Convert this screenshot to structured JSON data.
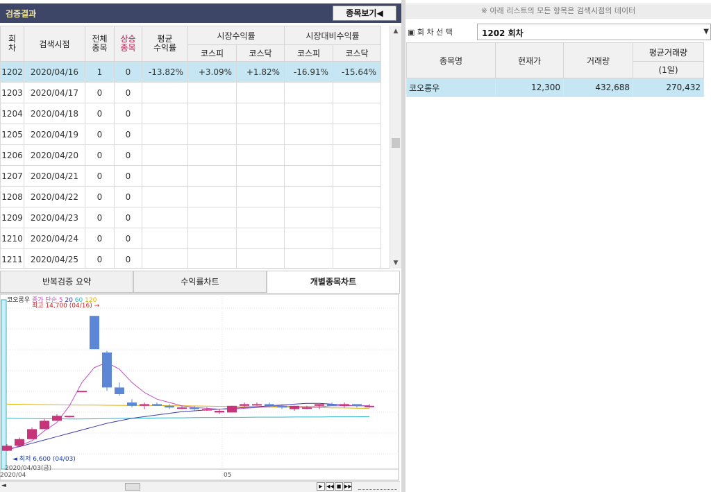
{
  "left": {
    "title": "검증결과",
    "toggle_button": "종목보기◀",
    "table": {
      "headers": {
        "round": "회\n차",
        "search_time": "검색시점",
        "total": "전체\n종목",
        "up": "상승\n종목",
        "avg_return": "평균\n수익률",
        "market_return": "시장수익률",
        "vs_market_return": "시장대비수익률",
        "kospi": "코스피",
        "kosdaq": "코스닥"
      },
      "rows": [
        {
          "round": "1202",
          "date": "2020/04/16",
          "total": "1",
          "up": "0",
          "avg": "-13.82%",
          "m_kospi": "+3.09%",
          "m_kosdaq": "+1.82%",
          "v_kospi": "-16.91%",
          "v_kosdaq": "-15.64%"
        },
        {
          "round": "1203",
          "date": "2020/04/17",
          "total": "0",
          "up": "0",
          "avg": "",
          "m_kospi": "",
          "m_kosdaq": "",
          "v_kospi": "",
          "v_kosdaq": ""
        },
        {
          "round": "1204",
          "date": "2020/04/18",
          "total": "0",
          "up": "0",
          "avg": "",
          "m_kospi": "",
          "m_kosdaq": "",
          "v_kospi": "",
          "v_kosdaq": ""
        },
        {
          "round": "1205",
          "date": "2020/04/19",
          "total": "0",
          "up": "0",
          "avg": "",
          "m_kospi": "",
          "m_kosdaq": "",
          "v_kospi": "",
          "v_kosdaq": ""
        },
        {
          "round": "1206",
          "date": "2020/04/20",
          "total": "0",
          "up": "0",
          "avg": "",
          "m_kospi": "",
          "m_kosdaq": "",
          "v_kospi": "",
          "v_kosdaq": ""
        },
        {
          "round": "1207",
          "date": "2020/04/21",
          "total": "0",
          "up": "0",
          "avg": "",
          "m_kospi": "",
          "m_kosdaq": "",
          "v_kospi": "",
          "v_kosdaq": ""
        },
        {
          "round": "1208",
          "date": "2020/04/22",
          "total": "0",
          "up": "0",
          "avg": "",
          "m_kospi": "",
          "m_kosdaq": "",
          "v_kospi": "",
          "v_kosdaq": ""
        },
        {
          "round": "1209",
          "date": "2020/04/23",
          "total": "0",
          "up": "0",
          "avg": "",
          "m_kospi": "",
          "m_kosdaq": "",
          "v_kospi": "",
          "v_kosdaq": ""
        },
        {
          "round": "1210",
          "date": "2020/04/24",
          "total": "0",
          "up": "0",
          "avg": "",
          "m_kospi": "",
          "m_kosdaq": "",
          "v_kospi": "",
          "v_kosdaq": ""
        },
        {
          "round": "1211",
          "date": "2020/04/25",
          "total": "0",
          "up": "0",
          "avg": "",
          "m_kospi": "",
          "m_kosdaq": "",
          "v_kospi": "",
          "v_kosdaq": ""
        }
      ]
    },
    "tabs": [
      "반복검증 요약",
      "수익률차트",
      "개별종목차트"
    ],
    "active_tab": 2,
    "chart": {
      "legend_stock": "코오롱우",
      "legend_ma_label": "종가 단순",
      "legend_ma": [
        "5",
        "20",
        "60",
        "120"
      ],
      "high_label": "최고 14,700 (04/16)",
      "low_label": "최저 6,600 (04/03)",
      "cursor_date": "2020/04/03(금)",
      "axis_labels": [
        "2020/04",
        "05"
      ]
    }
  },
  "right": {
    "notice": "※ 아래 리스트의 모든 항목은 검색시점의 데이터",
    "round_select_label": "회 차 선 택",
    "round_select_value": "1202 회차",
    "headers": {
      "name": "종목명",
      "price": "현재가",
      "volume": "거래량",
      "avg_volume": "평균거래량",
      "avg_volume_sub": "(1일)"
    },
    "rows": [
      {
        "name": "코오롱우",
        "price": "12,300",
        "volume": "432,688",
        "avg_volume": "270,432"
      }
    ]
  },
  "colors": {
    "title_bg": "#3e4668",
    "title_text": "#f2e39a",
    "selected_row": "#c7e6f3",
    "negative": "#2a5bd0",
    "positive": "#d0202d",
    "candle_up": "#c8347a",
    "candle_down": "#5b87d6"
  },
  "chart_data": {
    "type": "candlestick",
    "ylim": [
      6000,
      15500
    ],
    "candles": [
      {
        "o": 6600,
        "h": 7000,
        "l": 6600,
        "c": 6900
      },
      {
        "o": 6900,
        "h": 7400,
        "l": 6900,
        "c": 7300
      },
      {
        "o": 7300,
        "h": 8000,
        "l": 7300,
        "c": 7900
      },
      {
        "o": 7900,
        "h": 8500,
        "l": 7900,
        "c": 8400
      },
      {
        "o": 8400,
        "h": 8800,
        "l": 8400,
        "c": 8700
      },
      {
        "o": 8700,
        "h": 8700,
        "l": 8600,
        "c": 8700
      },
      {
        "o": 10200,
        "h": 10200,
        "l": 10200,
        "c": 10200
      },
      {
        "o": 14700,
        "h": 14700,
        "l": 12700,
        "c": 12700
      },
      {
        "o": 12500,
        "h": 12600,
        "l": 10200,
        "c": 10400
      },
      {
        "o": 10400,
        "h": 10700,
        "l": 9900,
        "c": 10000
      },
      {
        "o": 9500,
        "h": 9700,
        "l": 9200,
        "c": 9300
      },
      {
        "o": 9300,
        "h": 9500,
        "l": 9100,
        "c": 9400
      },
      {
        "o": 9400,
        "h": 9500,
        "l": 9300,
        "c": 9300
      },
      {
        "o": 9300,
        "h": 9400,
        "l": 9100,
        "c": 9200
      },
      {
        "o": 9200,
        "h": 9300,
        "l": 9100,
        "c": 9200
      },
      {
        "o": 9200,
        "h": 9300,
        "l": 9000,
        "c": 9100
      },
      {
        "o": 9100,
        "h": 9200,
        "l": 9000,
        "c": 9100
      },
      {
        "o": 8900,
        "h": 9100,
        "l": 8800,
        "c": 9000
      },
      {
        "o": 8900,
        "h": 9300,
        "l": 8900,
        "c": 9300
      },
      {
        "o": 9300,
        "h": 9500,
        "l": 9200,
        "c": 9400
      },
      {
        "o": 9400,
        "h": 9500,
        "l": 9300,
        "c": 9400
      },
      {
        "o": 9400,
        "h": 9500,
        "l": 9200,
        "c": 9300
      },
      {
        "o": 9300,
        "h": 9400,
        "l": 9100,
        "c": 9200
      },
      {
        "o": 9100,
        "h": 9300,
        "l": 9000,
        "c": 9300
      },
      {
        "o": 9200,
        "h": 9300,
        "l": 9100,
        "c": 9200
      },
      {
        "o": 9300,
        "h": 9400,
        "l": 9100,
        "c": 9400
      },
      {
        "o": 9400,
        "h": 9500,
        "l": 9300,
        "c": 9300
      },
      {
        "o": 9300,
        "h": 9500,
        "l": 9200,
        "c": 9400
      },
      {
        "o": 9400,
        "h": 9400,
        "l": 9200,
        "c": 9300
      },
      {
        "o": 9300,
        "h": 9400,
        "l": 9200,
        "c": 9300
      }
    ],
    "ma5": [
      6600,
      6900,
      7200,
      7800,
      8300,
      9300,
      10700,
      11600,
      11900,
      11500,
      10700,
      10100,
      9700,
      9500,
      9300,
      9200,
      9150,
      9100,
      9100,
      9150,
      9200,
      9250,
      9300,
      9250,
      9250,
      9250,
      9300,
      9300,
      9300,
      9300
    ],
    "ma20": [
      6700,
      6850,
      7050,
      7250,
      7450,
      7650,
      7850,
      8050,
      8250,
      8400,
      8550,
      8650,
      8750,
      8850,
      8950,
      9000,
      9050,
      9100,
      9150,
      9200,
      9250,
      9300,
      9350,
      9400,
      9450,
      9450,
      9400,
      9350,
      9300,
      9300
    ],
    "ma60": [
      8550,
      8540,
      8530,
      8520,
      8520,
      8510,
      8510,
      8520,
      8530,
      8540,
      8550,
      8560,
      8570,
      8580,
      8580,
      8590,
      8600,
      8600,
      8610,
      8610,
      8620,
      8620,
      8620,
      8630,
      8630,
      8630,
      8640,
      8640,
      8640,
      8650
    ],
    "ma120": [
      9400,
      9390,
      9380,
      9370,
      9360,
      9350,
      9345,
      9340,
      9335,
      9330,
      9325,
      9320,
      9315,
      9310,
      9300,
      9290,
      9280,
      9270,
      9260,
      9250,
      9240,
      9230,
      9220,
      9210,
      9200,
      9190,
      9180,
      9170,
      9160,
      9150
    ]
  }
}
